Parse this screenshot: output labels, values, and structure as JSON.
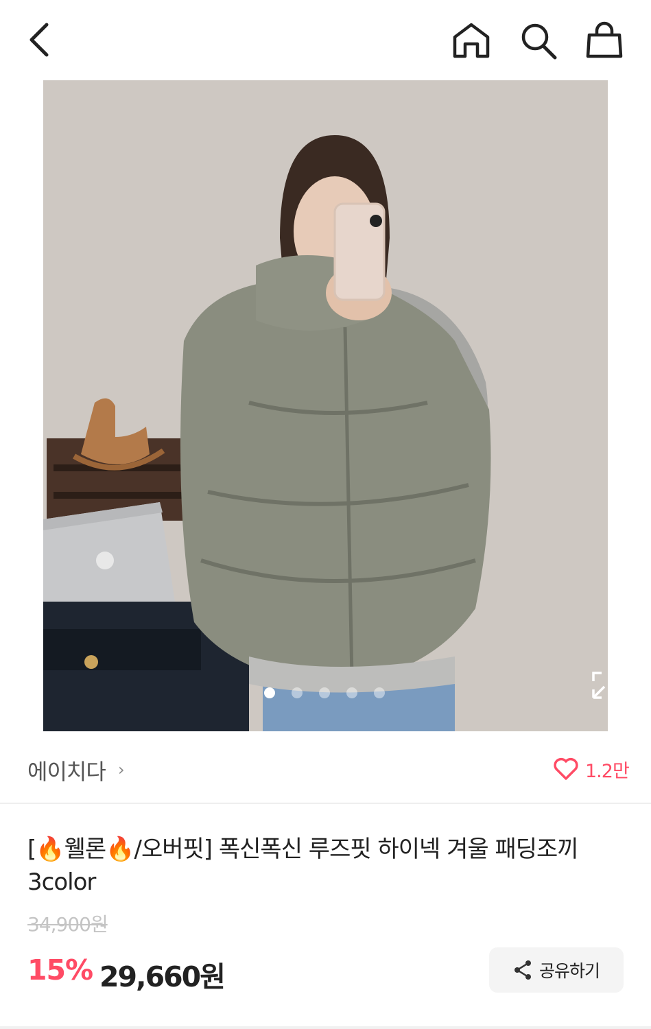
{
  "header": {
    "back_icon": "chevron-left-icon",
    "home_icon": "home-icon",
    "search_icon": "search-icon",
    "cart_icon": "shopping-bag-icon"
  },
  "gallery": {
    "image_count": 5,
    "active_index": 0,
    "expand_icon": "expand-icon"
  },
  "seller": {
    "name": "에이치다",
    "arrow": "›",
    "like_count": "1.2만",
    "like_icon": "heart-outline-icon"
  },
  "product": {
    "title": "[🔥웰론🔥/오버핏] 폭신폭신 루즈핏 하이넥 겨울 패딩조끼 3color",
    "original_price": "34,900원",
    "discount": "15%",
    "price": "29,660원"
  },
  "actions": {
    "share_label": "공유하기",
    "share_icon": "share-icon"
  },
  "colors": {
    "accent": "#ff4b65",
    "text": "#222222",
    "muted": "#c4c4c4"
  }
}
